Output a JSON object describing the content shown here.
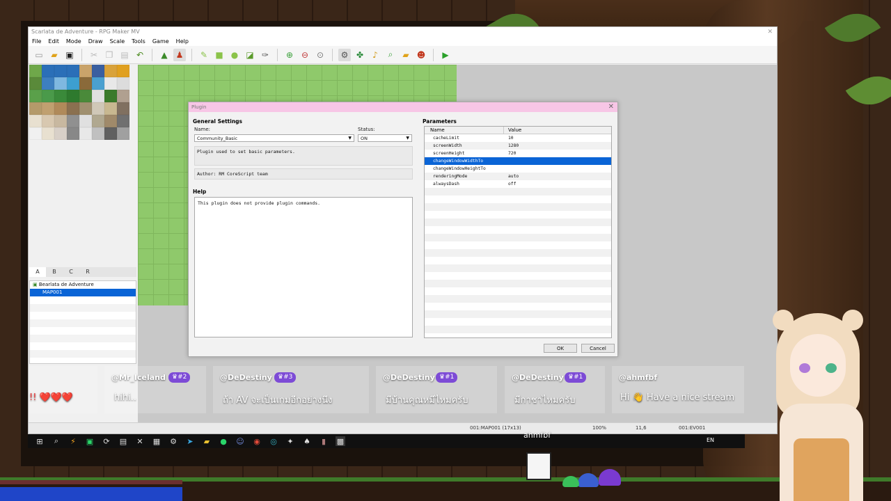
{
  "app": {
    "title": "Scarlata de Adventure - RPG Maker MV",
    "menu": [
      "File",
      "Edit",
      "Mode",
      "Draw",
      "Scale",
      "Tools",
      "Game",
      "Help"
    ],
    "tile_tabs": [
      "A",
      "B",
      "C",
      "R"
    ],
    "map_tree": {
      "project": "Bearlata de Adventure",
      "map": "MAP001"
    },
    "status": {
      "map": "001:MAP001 (17x13)",
      "zoom": "100%",
      "coords": "11,6",
      "event": "001:EV001"
    }
  },
  "dialog": {
    "title": "Plugin",
    "general_settings": "General Settings",
    "name_label": "Name:",
    "name_value": "Community_Basic",
    "status_label": "Status:",
    "status_value": "ON",
    "description": "Plugin used to set basic parameters.",
    "author": "Author: RM CoreScript team",
    "help_title": "Help",
    "help_text": "This plugin does not provide plugin commands.",
    "parameters_title": "Parameters",
    "col_name": "Name",
    "col_value": "Value",
    "params": [
      {
        "name": "cacheLimit",
        "value": "10"
      },
      {
        "name": "screenWidth",
        "value": "1280"
      },
      {
        "name": "screenHeight",
        "value": "720"
      },
      {
        "name": "changeWindowWidthTo",
        "value": ""
      },
      {
        "name": "changeWindowHeightTo",
        "value": ""
      },
      {
        "name": "renderingMode",
        "value": "auto"
      },
      {
        "name": "alwaysDash",
        "value": "off"
      }
    ],
    "ok": "OK",
    "cancel": "Cancel"
  },
  "chat": [
    {
      "user": "@Mr_Iceland",
      "badge": "♛#2",
      "msg": "hihi.."
    },
    {
      "user": "@DeDestiny",
      "badge": "♛#3",
      "msg": "ถ้า AV จะเป็นเกมอีกอย่างนึง"
    },
    {
      "user": "@DeDestiny",
      "badge": "♛#1",
      "msg": "มีบ้านคุณหมีไหมครับ"
    },
    {
      "user": "@DeDestiny",
      "badge": "♛#1",
      "msg": "มีกาชาไหมครับ"
    },
    {
      "user": "@ahmfbf",
      "badge": "",
      "msg": "Hi 👋 Have a nice stream"
    }
  ],
  "chat_partial": "!! ❤️❤️❤️",
  "stream_name": "ahmfbf",
  "taskbar": {
    "lang": "EN"
  }
}
